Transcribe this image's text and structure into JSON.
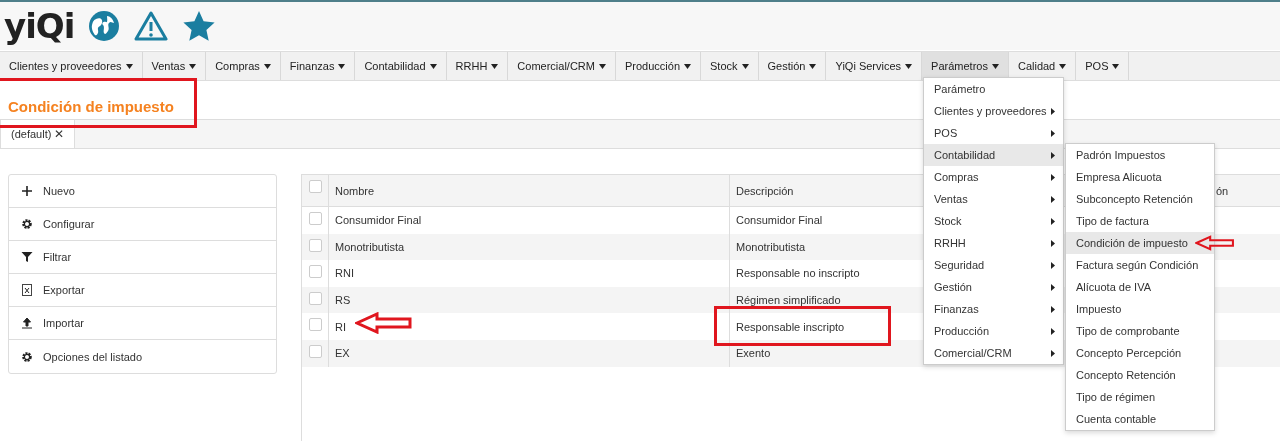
{
  "logo": "yiQi",
  "menu_bar": [
    {
      "label": "Clientes y proveedores",
      "selected": false
    },
    {
      "label": "Ventas",
      "selected": false
    },
    {
      "label": "Compras",
      "selected": false
    },
    {
      "label": "Finanzas",
      "selected": false
    },
    {
      "label": "Contabilidad",
      "selected": false
    },
    {
      "label": "RRHH",
      "selected": false
    },
    {
      "label": "Comercial/CRM",
      "selected": false
    },
    {
      "label": "Producción",
      "selected": false
    },
    {
      "label": "Stock",
      "selected": false
    },
    {
      "label": "Gestión",
      "selected": false
    },
    {
      "label": "YiQi Services",
      "selected": false
    },
    {
      "label": "Parámetros",
      "selected": true
    },
    {
      "label": "Calidad",
      "selected": false
    },
    {
      "label": "POS",
      "selected": false
    }
  ],
  "page_title": "Condición de impuesto",
  "tabs": [
    {
      "label": "(default)",
      "close": "✕",
      "selected": true
    }
  ],
  "actions": [
    {
      "kind": "plus",
      "label": "Nuevo"
    },
    {
      "kind": "gear",
      "label": "Configurar"
    },
    {
      "kind": "filter",
      "label": "Filtrar"
    },
    {
      "kind": "excel",
      "label": "Exportar"
    },
    {
      "kind": "upload",
      "label": "Importar"
    },
    {
      "kind": "gear",
      "label": "Opciones del listado"
    }
  ],
  "table": {
    "columns": [
      "Nombre",
      "Descripción",
      "ón"
    ],
    "header_checked": false,
    "rows": [
      {
        "checked": false,
        "cells": [
          "Consumidor Final",
          "Consumidor Final"
        ]
      },
      {
        "checked": false,
        "cells": [
          "Monotributista",
          "Monotributista"
        ]
      },
      {
        "checked": false,
        "cells": [
          "RNI",
          "Responsable no inscripto"
        ]
      },
      {
        "checked": false,
        "cells": [
          "RS",
          "Régimen simplificado"
        ]
      },
      {
        "checked": false,
        "cells": [
          "RI",
          "Responsable inscripto"
        ]
      },
      {
        "checked": false,
        "cells": [
          "EX",
          "Exento"
        ]
      }
    ]
  },
  "dropdown": {
    "items": [
      {
        "label": "Parámetro",
        "submenu": false,
        "selected": false
      },
      {
        "label": "Clientes y proveedores",
        "submenu": true,
        "selected": false
      },
      {
        "label": "POS",
        "submenu": true,
        "selected": false
      },
      {
        "label": "Contabilidad",
        "submenu": true,
        "selected": true
      },
      {
        "label": "Compras",
        "submenu": true,
        "selected": false
      },
      {
        "label": "Ventas",
        "submenu": true,
        "selected": false
      },
      {
        "label": "Stock",
        "submenu": true,
        "selected": false
      },
      {
        "label": "RRHH",
        "submenu": true,
        "selected": false
      },
      {
        "label": "Seguridad",
        "submenu": true,
        "selected": false
      },
      {
        "label": "Gestión",
        "submenu": true,
        "selected": false
      },
      {
        "label": "Finanzas",
        "submenu": true,
        "selected": false
      },
      {
        "label": "Producción",
        "submenu": true,
        "selected": false
      },
      {
        "label": "Comercial/CRM",
        "submenu": true,
        "selected": false
      }
    ]
  },
  "submenu": {
    "items": [
      {
        "label": "Padrón Impuestos",
        "selected": false
      },
      {
        "label": "Empresa Alicuota",
        "selected": false
      },
      {
        "label": "Subconcepto Retención",
        "selected": false
      },
      {
        "label": "Tipo de factura",
        "selected": false
      },
      {
        "label": "Condición de impuesto",
        "selected": true
      },
      {
        "label": "Factura según Condición",
        "selected": false
      },
      {
        "label": "Alícuota de IVA",
        "selected": false
      },
      {
        "label": "Impuesto",
        "selected": false
      },
      {
        "label": "Tipo de comprobante",
        "selected": false
      },
      {
        "label": "Concepto Percepción",
        "selected": false
      },
      {
        "label": "Concepto Retención",
        "selected": false
      },
      {
        "label": "Tipo de régimen",
        "selected": false
      },
      {
        "label": "Cuenta contable",
        "selected": false
      }
    ]
  }
}
